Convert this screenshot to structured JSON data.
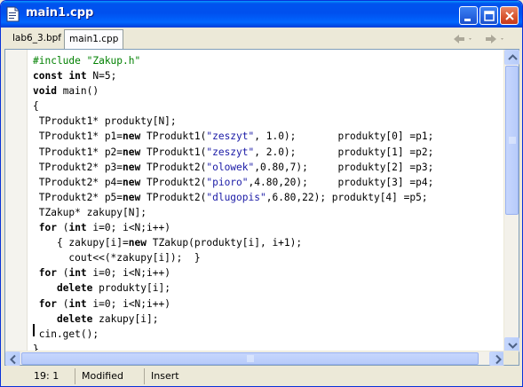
{
  "window": {
    "title": "main1.cpp"
  },
  "tabs": [
    {
      "label": "lab6_3.bpf",
      "active": false
    },
    {
      "label": "main1.cpp",
      "active": true
    }
  ],
  "nav": {
    "back_icon": "back-arrow-icon",
    "forward_icon": "forward-arrow-icon"
  },
  "code_lines": [
    [
      [
        "pp",
        "#include \"Zakup.h\""
      ]
    ],
    [
      [
        "kw",
        "const"
      ],
      [
        "",
        " "
      ],
      [
        "kw",
        "int"
      ],
      [
        "",
        " N=5;"
      ]
    ],
    [
      [
        "kw",
        "void"
      ],
      [
        "",
        " main()"
      ]
    ],
    [
      [
        "",
        "{"
      ]
    ],
    [
      [
        "",
        " TProdukt1* produkty[N];"
      ]
    ],
    [
      [
        "",
        " TProdukt1* p1="
      ],
      [
        "kw",
        "new"
      ],
      [
        "",
        " TProdukt1("
      ],
      [
        "str",
        "\"zeszyt\""
      ],
      [
        "",
        ", 1.0);       produkty[0] =p1;"
      ]
    ],
    [
      [
        "",
        " TProdukt1* p2="
      ],
      [
        "kw",
        "new"
      ],
      [
        "",
        " TProdukt1("
      ],
      [
        "str",
        "\"zeszyt\""
      ],
      [
        "",
        ", 2.0);       produkty[1] =p2;"
      ]
    ],
    [
      [
        "",
        " TProdukt2* p3="
      ],
      [
        "kw",
        "new"
      ],
      [
        "",
        " TProdukt2("
      ],
      [
        "str",
        "\"olowek\""
      ],
      [
        "",
        ",0.80,7);     produkty[2] =p3;"
      ]
    ],
    [
      [
        "",
        " TProdukt2* p4="
      ],
      [
        "kw",
        "new"
      ],
      [
        "",
        " TProdukt2("
      ],
      [
        "str",
        "\"pioro\""
      ],
      [
        "",
        ",4.80,20);     produkty[3] =p4;"
      ]
    ],
    [
      [
        "",
        " TProdukt2* p5="
      ],
      [
        "kw",
        "new"
      ],
      [
        "",
        " TProdukt2("
      ],
      [
        "str",
        "\"dlugopis\""
      ],
      [
        "",
        ",6.80,22); produkty[4] =p5;"
      ]
    ],
    [
      [
        "",
        " TZakup* zakupy[N];"
      ]
    ],
    [
      [
        "",
        " "
      ],
      [
        "kw",
        "for"
      ],
      [
        "",
        " ("
      ],
      [
        "kw",
        "int"
      ],
      [
        "",
        " i=0; i<N;i++)"
      ]
    ],
    [
      [
        "",
        "    { zakupy[i]="
      ],
      [
        "kw",
        "new"
      ],
      [
        "",
        " TZakup(produkty[i], i+1);"
      ]
    ],
    [
      [
        "",
        "      cout<<(*zakupy[i]);  }"
      ]
    ],
    [
      [
        "",
        " "
      ],
      [
        "kw",
        "for"
      ],
      [
        "",
        " ("
      ],
      [
        "kw",
        "int"
      ],
      [
        "",
        " i=0; i<N;i++)"
      ]
    ],
    [
      [
        "",
        "    "
      ],
      [
        "kw",
        "delete"
      ],
      [
        "",
        " produkty[i];"
      ]
    ],
    [
      [
        "",
        " "
      ],
      [
        "kw",
        "for"
      ],
      [
        "",
        " ("
      ],
      [
        "kw",
        "int"
      ],
      [
        "",
        " i=0; i<N;i++)"
      ]
    ],
    [
      [
        "",
        "    "
      ],
      [
        "kw",
        "delete"
      ],
      [
        "",
        " zakupy[i];"
      ]
    ],
    [
      [
        "",
        " cin.get();"
      ]
    ],
    [
      [
        "",
        "}"
      ]
    ]
  ],
  "status": {
    "position": "19:  1",
    "modified": "Modified",
    "mode": "Insert"
  },
  "colors": {
    "titlebar": "#0054e3",
    "keyword": "#000000",
    "preprocessor": "#008000",
    "string": "#1a1aa6"
  }
}
